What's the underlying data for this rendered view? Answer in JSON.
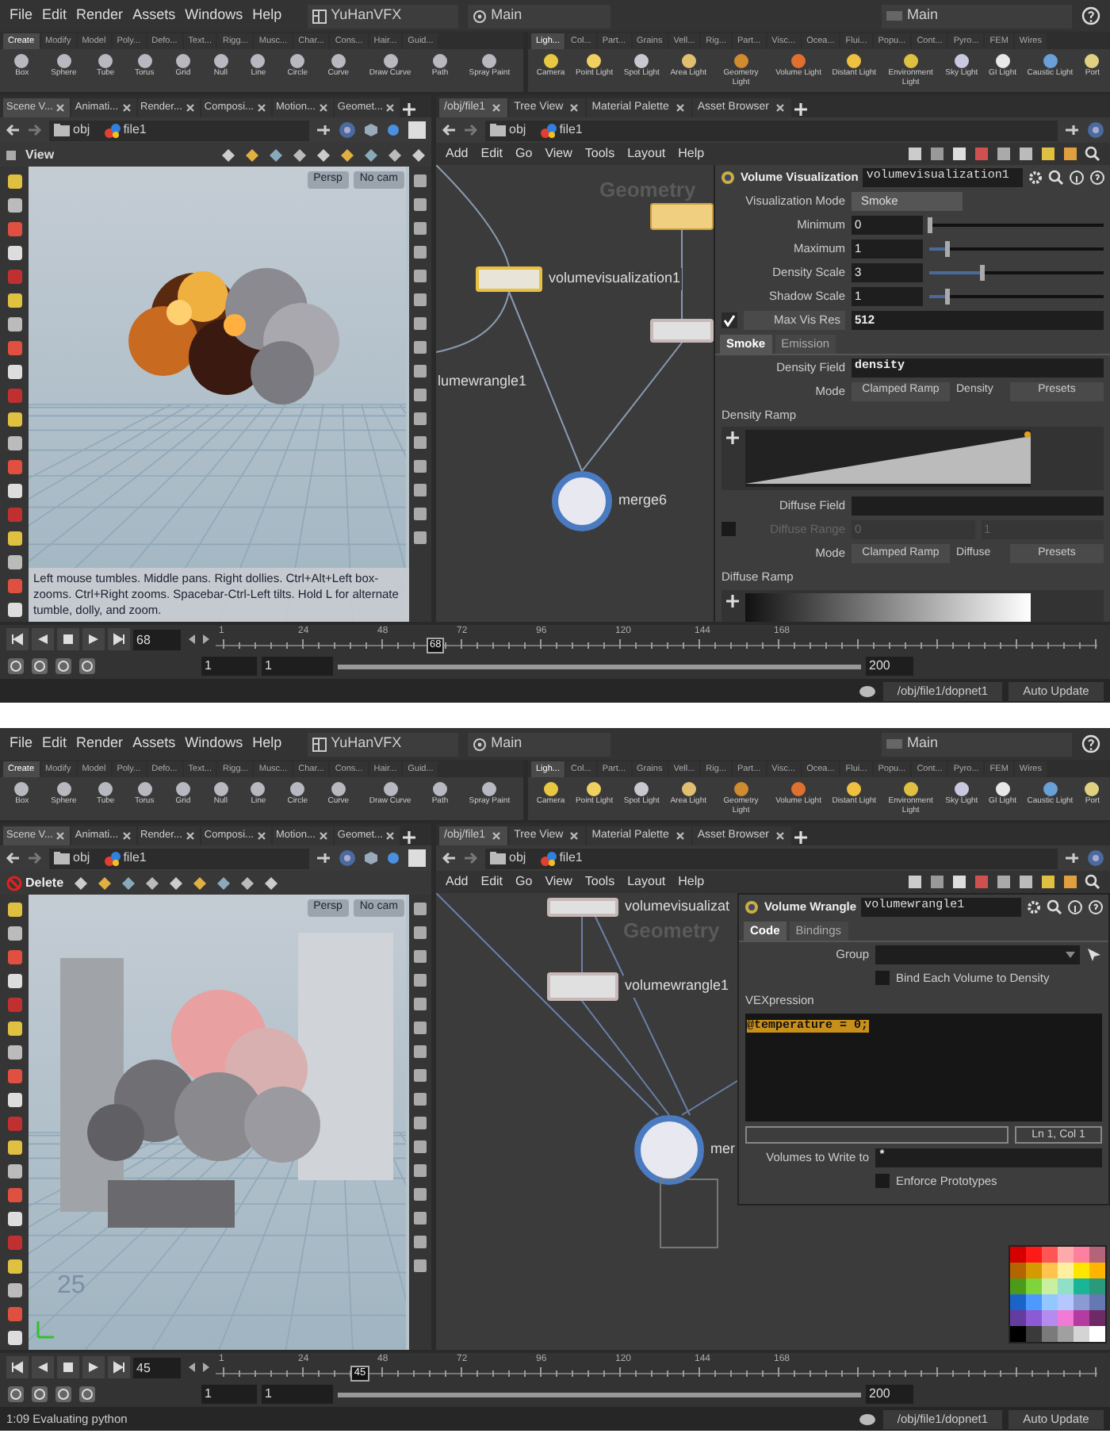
{
  "screens": [
    {
      "menu": [
        "File",
        "Edit",
        "Render",
        "Assets",
        "Windows",
        "Help"
      ],
      "desktop": "YuHanVFX",
      "layout": "Main",
      "right_layout": "Main",
      "shelf_left_tabs": [
        {
          "label": "Create",
          "selected": true
        },
        {
          "label": "Modify",
          "selected": false
        },
        {
          "label": "Model",
          "selected": false
        },
        {
          "label": "Poly...",
          "selected": false
        },
        {
          "label": "Defo...",
          "selected": false
        },
        {
          "label": "Text...",
          "selected": false
        },
        {
          "label": "Rigg...",
          "selected": false
        },
        {
          "label": "Musc...",
          "selected": false
        },
        {
          "label": "Char...",
          "selected": false
        },
        {
          "label": "Cons...",
          "selected": false
        },
        {
          "label": "Hair...",
          "selected": false
        },
        {
          "label": "Guid...",
          "selected": false
        }
      ],
      "shelf_left_tools": [
        "Box",
        "Sphere",
        "Tube",
        "Torus",
        "Grid",
        "Null",
        "Line",
        "Circle",
        "Curve",
        "Draw Curve",
        "Path",
        "Spray Paint"
      ],
      "shelf_right_tabs": [
        {
          "label": "Ligh...",
          "selected": true
        },
        {
          "label": "Col...",
          "selected": false
        },
        {
          "label": "Part...",
          "selected": false
        },
        {
          "label": "Grains",
          "selected": false
        },
        {
          "label": "Vell...",
          "selected": false
        },
        {
          "label": "Rig...",
          "selected": false
        },
        {
          "label": "Part...",
          "selected": false
        },
        {
          "label": "Visc...",
          "selected": false
        },
        {
          "label": "Ocea...",
          "selected": false
        },
        {
          "label": "Flui...",
          "selected": false
        },
        {
          "label": "Popu...",
          "selected": false
        },
        {
          "label": "Cont...",
          "selected": false
        },
        {
          "label": "Pyro...",
          "selected": false
        },
        {
          "label": "FEM",
          "selected": false
        },
        {
          "label": "Wires",
          "selected": false
        }
      ],
      "shelf_right_tools": [
        "Camera",
        "Point Light",
        "Spot Light",
        "Area Light",
        "Geometry Light",
        "Volume Light",
        "Distant Light",
        "Environment Light",
        "Sky Light",
        "GI Light",
        "Caustic Light",
        "Port"
      ],
      "left_tabs": [
        {
          "label": "Scene V...",
          "selected": true
        },
        {
          "label": "Animati...",
          "selected": false
        },
        {
          "label": "Render...",
          "selected": false
        },
        {
          "label": "Composi...",
          "selected": false
        },
        {
          "label": "Motion...",
          "selected": false
        },
        {
          "label": "Geomet...",
          "selected": false
        }
      ],
      "right_tabs": [
        {
          "label": "/obj/file1",
          "selected": true
        },
        {
          "label": "Tree View",
          "selected": false
        },
        {
          "label": "Material Palette",
          "selected": false
        },
        {
          "label": "Asset Browser",
          "selected": false
        }
      ],
      "left_path": [
        "obj",
        "file1"
      ],
      "right_path": [
        "obj",
        "file1"
      ],
      "viewport": {
        "header": "View",
        "kind": "fire",
        "camera": "Persp",
        "cam": "No cam",
        "help_text": "Left mouse tumbles. Middle pans. Right dollies. Ctrl+Alt+Left box-zooms. Ctrl+Right zooms. Spacebar-Ctrl-Left tilts. Hold L for alternate tumble, dolly, and zoom."
      },
      "network": {
        "menu": [
          "Add",
          "Edit",
          "Go",
          "View",
          "Tools",
          "Layout",
          "Help"
        ],
        "context": "Geometry",
        "nodes": [
          {
            "kind": "folder",
            "selected": false
          },
          {
            "kind": "box",
            "label": "volumevisualization1",
            "selected": true
          },
          {
            "kind": "box",
            "selected": false
          },
          {
            "kind": "label",
            "label": "lumewrangle1"
          },
          {
            "kind": "merge",
            "label": "merge6",
            "selected": false
          }
        ]
      },
      "params": {
        "kind": "docked",
        "type": "Volume Visualization",
        "name": "volumevisualization1",
        "rows": [
          {
            "kind": "menu",
            "label": "Visualization Mode",
            "value": "Smoke"
          },
          {
            "kind": "slider",
            "label": "Minimum",
            "value": "0",
            "level": 0
          },
          {
            "kind": "slider",
            "label": "Maximum",
            "value": "1",
            "level": 0.1
          },
          {
            "kind": "slider",
            "label": "Density Scale",
            "value": "3",
            "level": 0.3
          },
          {
            "kind": "slider",
            "label": "Shadow Scale",
            "value": "1",
            "level": 0.1
          },
          {
            "kind": "toggle_field",
            "label": "Max Vis Res",
            "value": "512",
            "checked": true
          },
          {
            "kind": "tabs",
            "tabs": [
              {
                "label": "Smoke",
                "selected": true
              },
              {
                "label": "Emission",
                "selected": false
              }
            ]
          },
          {
            "kind": "field",
            "label": "Density Field",
            "value": "density"
          },
          {
            "kind": "mode",
            "label": "Mode",
            "value": "Clamped Ramp",
            "sublabel": "Density",
            "presets": "Presets"
          },
          {
            "kind": "density_ramp",
            "label": "Density Ramp"
          },
          {
            "kind": "field",
            "label": "Diffuse Field"
          },
          {
            "kind": "range",
            "label": "Diffuse Range",
            "values": [
              "0",
              "1"
            ],
            "checked": false,
            "disabled": true
          },
          {
            "kind": "mode",
            "label": "Mode",
            "value": "Clamped Ramp",
            "sublabel": "Diffuse",
            "presets": "Presets"
          },
          {
            "kind": "color_ramp",
            "label": "Diffuse Ramp"
          }
        ]
      },
      "timeline": {
        "frame": "68",
        "ticks": [
          "1",
          "24",
          "48",
          "72",
          "96",
          "120",
          "144",
          "168"
        ],
        "playhead": {
          "label": "68",
          "level": 0.25
        },
        "start": "1",
        "start2": "1",
        "end": "200"
      },
      "status": {
        "path": "/obj/file1/dopnet1",
        "update": "Auto Update"
      }
    },
    {
      "menu": [
        "File",
        "Edit",
        "Render",
        "Assets",
        "Windows",
        "Help"
      ],
      "desktop": "YuHanVFX",
      "layout": "Main",
      "right_layout": "Main",
      "shelf_left_tabs": [
        {
          "label": "Create",
          "selected": true
        },
        {
          "label": "Modify",
          "selected": false
        },
        {
          "label": "Model",
          "selected": false
        },
        {
          "label": "Poly...",
          "selected": false
        },
        {
          "label": "Defo...",
          "selected": false
        },
        {
          "label": "Text...",
          "selected": false
        },
        {
          "label": "Rigg...",
          "selected": false
        },
        {
          "label": "Musc...",
          "selected": false
        },
        {
          "label": "Char...",
          "selected": false
        },
        {
          "label": "Cons...",
          "selected": false
        },
        {
          "label": "Hair...",
          "selected": false
        },
        {
          "label": "Guid...",
          "selected": false
        }
      ],
      "shelf_left_tools": [
        "Box",
        "Sphere",
        "Tube",
        "Torus",
        "Grid",
        "Null",
        "Line",
        "Circle",
        "Curve",
        "Draw Curve",
        "Path",
        "Spray Paint"
      ],
      "shelf_right_tabs": [
        {
          "label": "Ligh...",
          "selected": true
        },
        {
          "label": "Col...",
          "selected": false
        },
        {
          "label": "Part...",
          "selected": false
        },
        {
          "label": "Grains",
          "selected": false
        },
        {
          "label": "Vell...",
          "selected": false
        },
        {
          "label": "Rig...",
          "selected": false
        },
        {
          "label": "Part...",
          "selected": false
        },
        {
          "label": "Visc...",
          "selected": false
        },
        {
          "label": "Ocea...",
          "selected": false
        },
        {
          "label": "Flui...",
          "selected": false
        },
        {
          "label": "Popu...",
          "selected": false
        },
        {
          "label": "Cont...",
          "selected": false
        },
        {
          "label": "Pyro...",
          "selected": false
        },
        {
          "label": "FEM",
          "selected": false
        },
        {
          "label": "Wires",
          "selected": false
        }
      ],
      "shelf_right_tools": [
        "Camera",
        "Point Light",
        "Spot Light",
        "Area Light",
        "Geometry Light",
        "Volume Light",
        "Distant Light",
        "Environment Light",
        "Sky Light",
        "GI Light",
        "Caustic Light",
        "Port"
      ],
      "left_tabs": [
        {
          "label": "Scene V...",
          "selected": true
        },
        {
          "label": "Animati...",
          "selected": false
        },
        {
          "label": "Render...",
          "selected": false
        },
        {
          "label": "Composi...",
          "selected": false
        },
        {
          "label": "Motion...",
          "selected": false
        },
        {
          "label": "Geomet...",
          "selected": false
        }
      ],
      "right_tabs": [
        {
          "label": "/obj/file1",
          "selected": true
        },
        {
          "label": "Tree View",
          "selected": false
        },
        {
          "label": "Material Palette",
          "selected": false
        },
        {
          "label": "Asset Browser",
          "selected": false
        }
      ],
      "left_path": [
        "obj",
        "file1"
      ],
      "right_path": [
        "obj",
        "file1"
      ],
      "viewport": {
        "header": "Delete",
        "kind": "smoke_debris",
        "camera": "Persp",
        "cam": "No cam",
        "grid_label": "25"
      },
      "network": {
        "menu": [
          "Add",
          "Edit",
          "Go",
          "View",
          "Tools",
          "Layout",
          "Help"
        ],
        "context": "Geometry",
        "nodes": [
          {
            "kind": "box",
            "label": "volumevisualizat",
            "selected": false
          },
          {
            "kind": "box",
            "label": "volumewrangle1",
            "selected": false
          },
          {
            "kind": "merge",
            "label": "mer",
            "selected": false
          },
          {
            "kind": "netbox"
          }
        ],
        "palette": [
          {
            "color": "#d40000"
          },
          {
            "color": "#ff1a1a"
          },
          {
            "color": "#ff5555"
          },
          {
            "color": "#ffaaaa"
          },
          {
            "color": "#ff7f9f"
          },
          {
            "color": "#b46478"
          },
          {
            "color": "#b46400"
          },
          {
            "color": "#d49a00"
          },
          {
            "color": "#ffc44d"
          },
          {
            "color": "#fff0a0"
          },
          {
            "color": "#ffe600"
          },
          {
            "color": "#ffb400"
          },
          {
            "color": "#4d9a1a"
          },
          {
            "color": "#7fd43a"
          },
          {
            "color": "#c8f0a0"
          },
          {
            "color": "#90e0c8"
          },
          {
            "color": "#1ab496"
          },
          {
            "color": "#2a9a7a"
          },
          {
            "color": "#1a64c8"
          },
          {
            "color": "#4d9aff"
          },
          {
            "color": "#90c8ff"
          },
          {
            "color": "#b4c8ff"
          },
          {
            "color": "#8c9ad4"
          },
          {
            "color": "#6478b4"
          },
          {
            "color": "#643ca0"
          },
          {
            "color": "#8c5ad4"
          },
          {
            "color": "#b48cf0"
          },
          {
            "color": "#f07ad4"
          },
          {
            "color": "#b43ca0"
          },
          {
            "color": "#6e2a64"
          },
          {
            "color": "#000000"
          },
          {
            "color": "#3a3a3a"
          },
          {
            "color": "#7a7a7a"
          },
          {
            "color": "#a0a0a0"
          },
          {
            "color": "#d4d4d4"
          },
          {
            "color": "#ffffff"
          }
        ]
      },
      "params": {
        "kind": "floating",
        "type": "Volume Wrangle",
        "name": "volumewrangle1",
        "rows": [
          {
            "kind": "tabs",
            "tabs": [
              {
                "label": "Code",
                "selected": true
              },
              {
                "label": "Bindings",
                "selected": false
              }
            ]
          },
          {
            "kind": "field",
            "label": "Group",
            "dropdown": true
          },
          {
            "kind": "checkbox",
            "label": "Bind Each Volume to Density",
            "checked": false
          },
          {
            "kind": "label",
            "label": "VEXpression"
          },
          {
            "kind": "code",
            "value": "@temperature = 0;"
          },
          {
            "kind": "cursor_status",
            "value": "Ln 1, Col 1"
          },
          {
            "kind": "field",
            "label": "Volumes to Write to",
            "value": "*"
          },
          {
            "kind": "checkbox",
            "label": "Enforce Prototypes",
            "checked": false
          }
        ]
      },
      "timeline": {
        "frame": "45",
        "ticks": [
          "1",
          "24",
          "48",
          "72",
          "96",
          "120",
          "144",
          "168"
        ],
        "playhead": {
          "label": "45",
          "level": 0.165
        },
        "start": "1",
        "start2": "1",
        "end": "200"
      },
      "status": {
        "message": "1:09 Evaluating python",
        "path": "/obj/file1/dopnet1",
        "update": "Auto Update"
      }
    }
  ]
}
